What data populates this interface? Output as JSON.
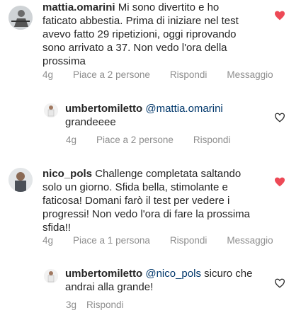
{
  "comments": [
    {
      "username": "mattia.omarini",
      "text": "Mi sono divertito e ho faticato abbestia. Prima di iniziare nel test avevo fatto 29 ripetizioni, oggi riprovando sono arrivato a 37. Non vedo l'ora della prossima",
      "time": "4g",
      "likes": "Piace a 2 persone",
      "reply_label": "Rispondi",
      "message_label": "Messaggio",
      "liked": true,
      "reply": {
        "username": "umbertomiletto",
        "mention": "@mattia.omarini",
        "text": "grandeeee",
        "time": "4g",
        "likes": "Piace a 2 persone",
        "reply_label": "Rispondi",
        "liked": false
      }
    },
    {
      "username": "nico_pols",
      "text": "Challenge completata saltando solo un giorno. Sfida bella, stimolante e faticosa! Domani farò il test per vedere i progressi! Non vedo l'ora di fare la prossima sfida!!",
      "time": "4g",
      "likes": "Piace a 1 persona",
      "reply_label": "Rispondi",
      "message_label": "Messaggio",
      "liked": true,
      "reply": {
        "username": "umbertomiletto",
        "mention": "@nico_pols",
        "text": "sicuro che andrai alla grande!",
        "time": "3g",
        "reply_label": "Rispondi",
        "liked": false
      }
    }
  ],
  "colors": {
    "liked_heart": "#ed4956",
    "muted": "#8e8e8e",
    "mention": "#00376b"
  }
}
